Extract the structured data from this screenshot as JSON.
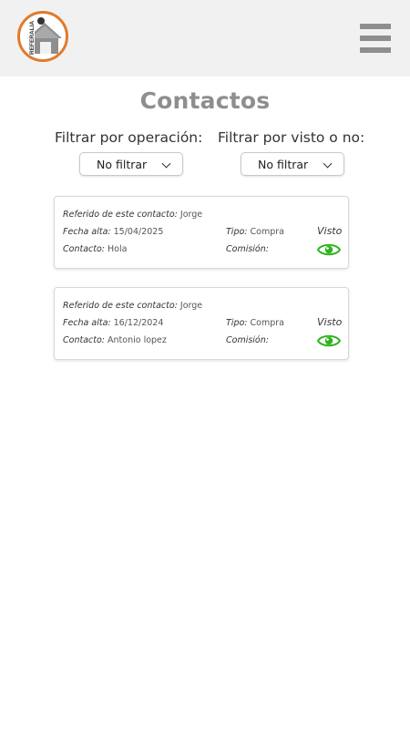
{
  "header": {
    "logo_text": "REFERALIA",
    "menu_icon": "hamburger-menu-icon"
  },
  "page": {
    "title": "Contactos"
  },
  "filters": {
    "operation_label": "Filtrar por operación:",
    "operation_value": "No filtrar",
    "seen_label": "Filtrar por visto o no:",
    "seen_value": "No filtrar"
  },
  "labels": {
    "referred": "Referido de este contacto:",
    "date": "Fecha alta:",
    "contact": "Contacto:",
    "type": "Tipo:",
    "commission": "Comisión:",
    "seen": "Visto"
  },
  "contacts": [
    {
      "referred_by": "Jorge",
      "date": "15/04/2025",
      "contact": "Hola",
      "type": "Compra",
      "commission": "",
      "seen": "Visto",
      "icon": "eye-icon"
    },
    {
      "referred_by": "Jorge",
      "date": "16/12/2024",
      "contact": "Antonio lopez",
      "type": "Compra",
      "commission": "",
      "seen": "Visto",
      "icon": "eye-icon"
    }
  ],
  "colors": {
    "accent_orange": "#e07a2c",
    "title_gray": "#8e8e8e",
    "eye_green": "#2fb31f",
    "header_bg": "#f1f1f1"
  }
}
